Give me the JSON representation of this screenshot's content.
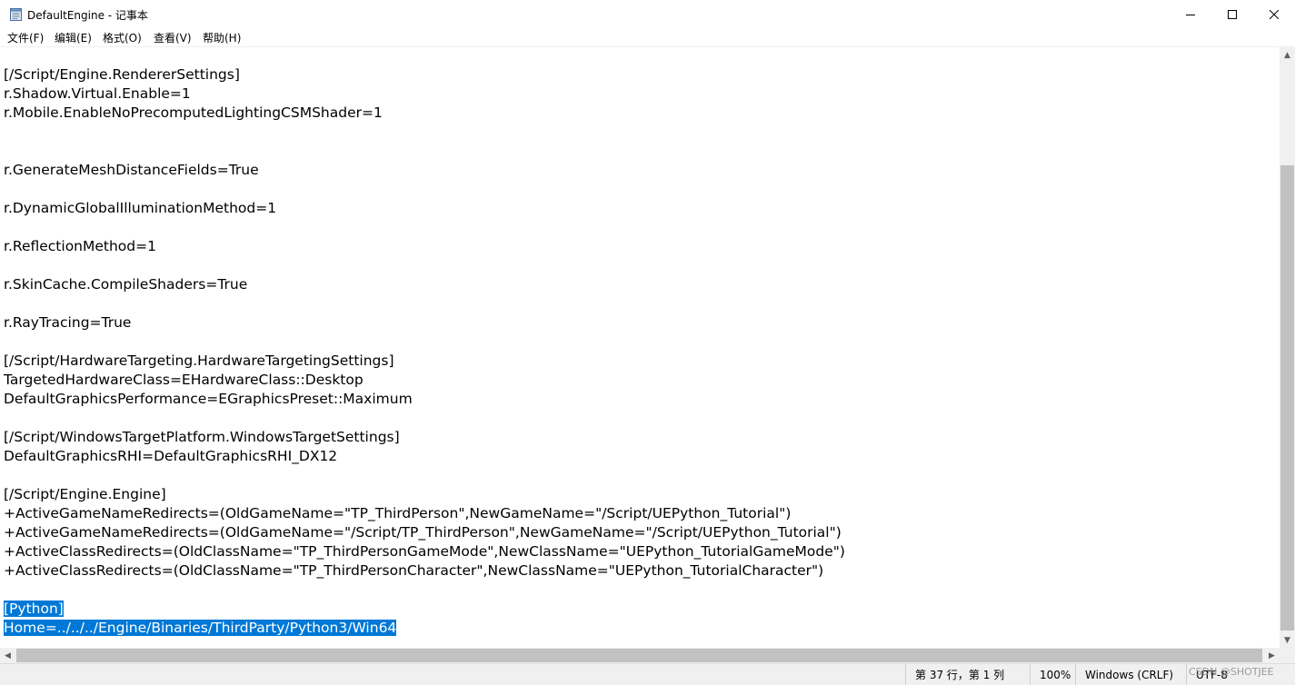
{
  "window": {
    "title": "DefaultEngine - 记事本",
    "minimize_glyph": "—",
    "maximize_glyph": "☐",
    "close_glyph": "✕"
  },
  "menu": [
    {
      "label": "文件(F)"
    },
    {
      "label": "编辑(E)"
    },
    {
      "label": "格式(O)"
    },
    {
      "label": "查看(V)"
    },
    {
      "label": "帮助(H)"
    }
  ],
  "editor": {
    "lines": [
      "[/Script/Engine.RendererSettings]",
      "r.Shadow.Virtual.Enable=1",
      "r.Mobile.EnableNoPrecomputedLightingCSMShader=1",
      "",
      "",
      "r.GenerateMeshDistanceFields=True",
      "",
      "r.DynamicGlobalIlluminationMethod=1",
      "",
      "r.ReflectionMethod=1",
      "",
      "r.SkinCache.CompileShaders=True",
      "",
      "r.RayTracing=True",
      "",
      "[/Script/HardwareTargeting.HardwareTargetingSettings]",
      "TargetedHardwareClass=EHardwareClass::Desktop",
      "DefaultGraphicsPerformance=EGraphicsPreset::Maximum",
      "",
      "[/Script/WindowsTargetPlatform.WindowsTargetSettings]",
      "DefaultGraphicsRHI=DefaultGraphicsRHI_DX12",
      "",
      "[/Script/Engine.Engine]",
      "+ActiveGameNameRedirects=(OldGameName=\"TP_ThirdPerson\",NewGameName=\"/Script/UEPython_Tutorial\")",
      "+ActiveGameNameRedirects=(OldGameName=\"/Script/TP_ThirdPerson\",NewGameName=\"/Script/UEPython_Tutorial\")",
      "+ActiveClassRedirects=(OldClassName=\"TP_ThirdPersonGameMode\",NewClassName=\"UEPython_TutorialGameMode\")",
      "+ActiveClassRedirects=(OldClassName=\"TP_ThirdPersonCharacter\",NewClassName=\"UEPython_TutorialCharacter\")",
      "",
      "[Python]",
      "Home=../../../Engine/Binaries/ThirdParty/Python3/Win64"
    ],
    "selected_lines": [
      28,
      29
    ],
    "selection_color": "#0078d7"
  },
  "status": {
    "position": "第 37 行，第 1 列",
    "zoom": "100%",
    "line_ending": "Windows (CRLF)",
    "encoding": "UTF-8"
  },
  "watermark": "CSDN @SHOTJEE"
}
